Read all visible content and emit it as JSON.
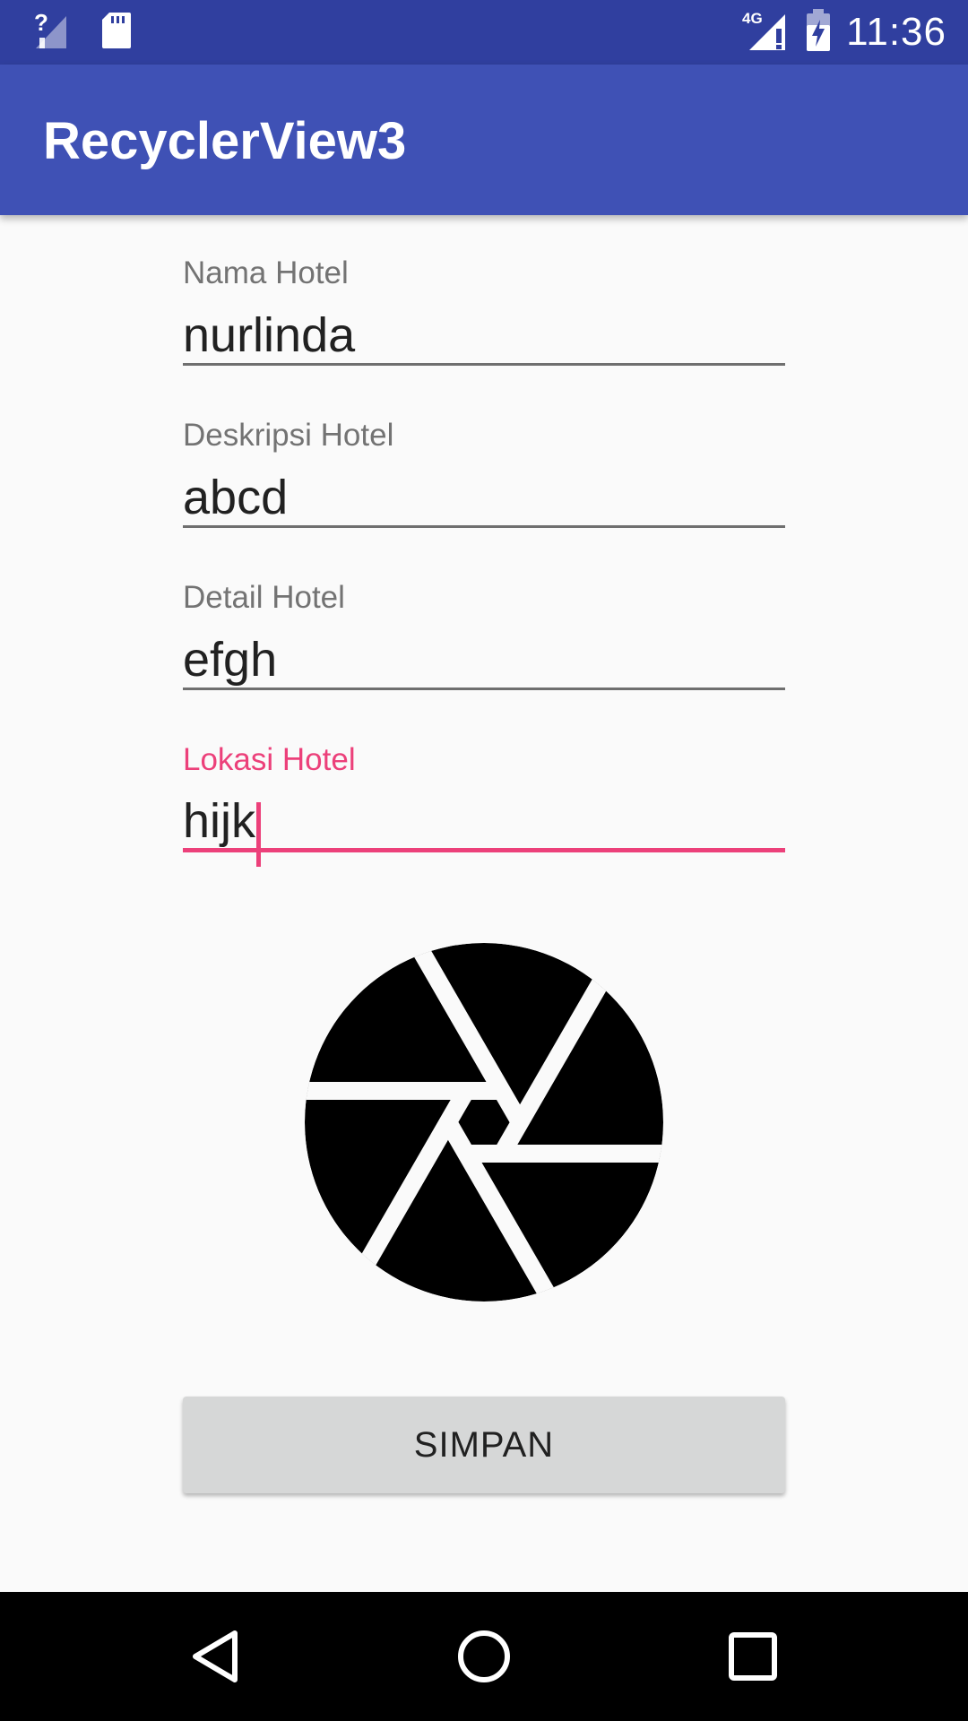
{
  "status_bar": {
    "time": "11:36",
    "network_label": "4G",
    "icons": [
      "wifi-unknown-icon",
      "sd-card-icon",
      "signal-4g-icon",
      "battery-charging-icon"
    ]
  },
  "app_bar": {
    "title": "RecyclerView3"
  },
  "form": {
    "fields": [
      {
        "label": "Nama Hotel",
        "value": "nurlinda",
        "focused": false
      },
      {
        "label": "Deskripsi Hotel",
        "value": "abcd",
        "focused": false
      },
      {
        "label": "Detail Hotel",
        "value": "efgh",
        "focused": false
      },
      {
        "label": "Lokasi Hotel",
        "value": "hijk",
        "focused": true
      }
    ],
    "image_icon": "aperture-icon",
    "save_label": "SIMPAN"
  },
  "nav_bar": {
    "icons": [
      "back-icon",
      "home-icon",
      "recents-icon"
    ]
  },
  "colors": {
    "status_bar": "#303f9f",
    "app_bar": "#3f51b5",
    "accent": "#ec407a",
    "button": "#d6d7d7"
  }
}
